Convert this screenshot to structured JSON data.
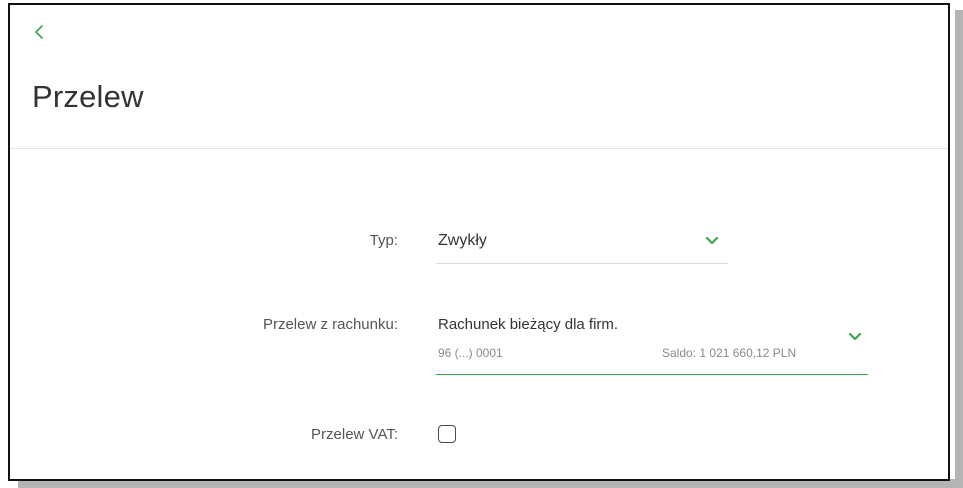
{
  "header": {
    "back_icon": "chevron-left-icon",
    "title": "Przelew"
  },
  "form": {
    "type": {
      "label": "Typ:",
      "value": "Zwykły",
      "icon": "chevron-down-icon"
    },
    "account": {
      "label": "Przelew z rachunku:",
      "name": "Rachunek bieżący dla firm.",
      "number": "96 (...) 0001",
      "balance": "Saldo: 1 021 660,12 PLN",
      "icon": "chevron-down-icon"
    },
    "vat": {
      "label": "Przelew VAT:",
      "checked": false
    }
  },
  "colors": {
    "accent": "#3aa64a",
    "text": "#333333",
    "muted": "#8a8a8a"
  }
}
